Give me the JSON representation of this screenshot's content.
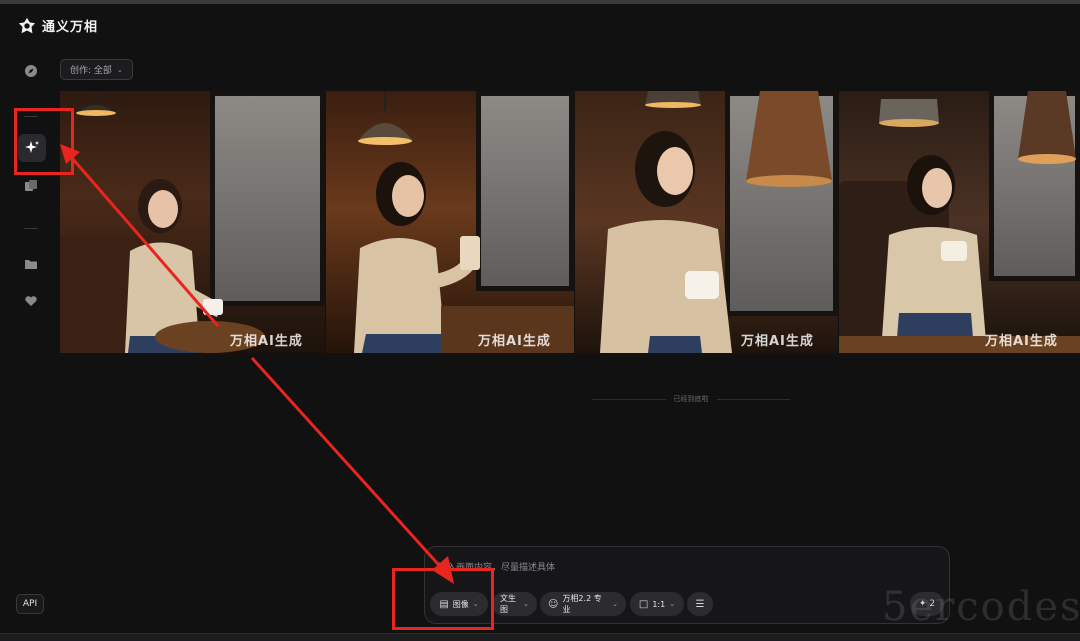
{
  "app": {
    "name": "通义万相"
  },
  "sidebar": {
    "items": [
      {
        "icon": "compass-icon"
      },
      {
        "icon": "sparkle-icon",
        "active": true
      },
      {
        "icon": "layers-icon"
      },
      {
        "icon": "folder-icon"
      },
      {
        "icon": "heart-icon"
      }
    ],
    "api_label": "API"
  },
  "filter": {
    "label": "创作: 全部"
  },
  "gallery": {
    "watermark": "万相AI生成",
    "images": [
      {
        "alt": "woman-in-cafe-1"
      },
      {
        "alt": "woman-in-cafe-2"
      },
      {
        "alt": "woman-in-cafe-3"
      },
      {
        "alt": "woman-in-cafe-4"
      }
    ]
  },
  "end_text": "已经到底啦",
  "composer": {
    "placeholder": "输入画面内容，尽量描述具体",
    "mode_label": "图像",
    "task_label": "文生图",
    "model_label": "万相2.2 专业",
    "ratio_label": "1:1",
    "generate_count": "2"
  },
  "site_watermark": "5ercodes",
  "colors": {
    "highlight": "#e8251f",
    "background": "#111112"
  }
}
